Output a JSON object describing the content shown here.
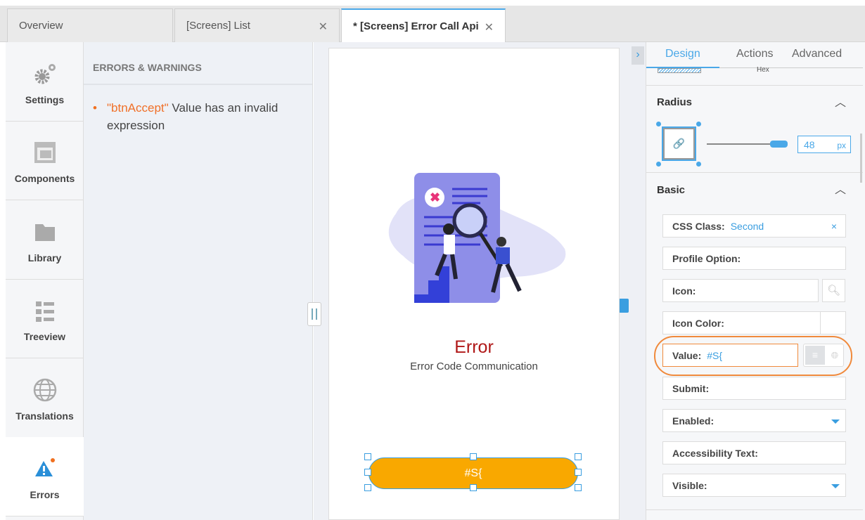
{
  "tabs": [
    {
      "label": "Overview"
    },
    {
      "label": "[Screens] List"
    },
    {
      "label": "* [Screens] Error Call Api",
      "active": true
    }
  ],
  "sidebar": {
    "items": [
      {
        "label": "Settings",
        "icon": "gears-icon"
      },
      {
        "label": "Components",
        "icon": "components-icon"
      },
      {
        "label": "Library",
        "icon": "folder-icon"
      },
      {
        "label": "Treeview",
        "icon": "treeview-icon"
      },
      {
        "label": "Translations",
        "icon": "globe-icon"
      },
      {
        "label": "Errors",
        "icon": "warning-icon",
        "active": true
      }
    ]
  },
  "errors": {
    "title": "ERRORS & WARNINGS",
    "items": [
      {
        "control": "\"btnAccept\"",
        "message": " Value has an invalid expression"
      }
    ]
  },
  "screen": {
    "title": "Error",
    "subtitle": "Error Code Communication",
    "button_label": "#S{"
  },
  "colors": {
    "accent": "#3a9ee0",
    "error_title": "#b01818",
    "button": "#f9a800",
    "highlight": "#f08a3c"
  },
  "right_panel": {
    "tabs": [
      "Design",
      "Actions",
      "Advanced"
    ],
    "active_tab": "Design",
    "clipped_label": "Hex",
    "radius": {
      "title": "Radius",
      "value": "48",
      "unit": "px"
    },
    "basic": {
      "title": "Basic",
      "fields": [
        {
          "label": "CSS Class:",
          "value": "Second"
        },
        {
          "label": "Profile Option:",
          "value": ""
        },
        {
          "label": "Icon:",
          "value": ""
        },
        {
          "label": "Icon Color:",
          "value": ""
        },
        {
          "label": "Value:",
          "value": "#S{"
        },
        {
          "label": "Submit:",
          "value": ""
        },
        {
          "label": "Enabled:",
          "value": ""
        },
        {
          "label": "Accessibility Text:",
          "value": ""
        },
        {
          "label": "Visible:",
          "value": ""
        }
      ]
    },
    "clear_symbol": "×"
  }
}
